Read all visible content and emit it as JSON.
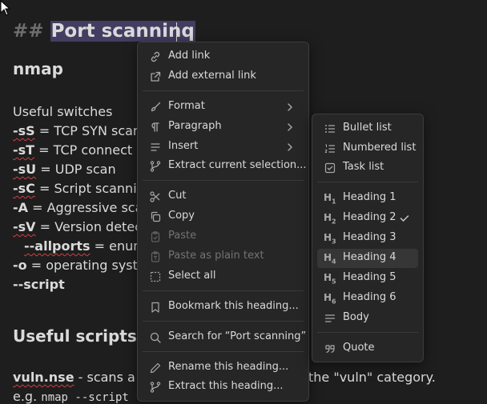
{
  "doc": {
    "heading_hash": "##",
    "heading_text": "Port scanning",
    "heading_visible": "Port scanninq",
    "h3_nmap": "nmap",
    "useful_switches": "Useful switches",
    "lines": [
      {
        "flag": "-sS",
        "rest": " = TCP SYN scan"
      },
      {
        "flag": "-sT",
        "rest": " = TCP connect s"
      },
      {
        "flag": "-sU",
        "rest": " = UDP scan"
      },
      {
        "flag": "-sC",
        "rest": " = Script scannin"
      },
      {
        "flag": "-A",
        "rest": " = Aggressive sca"
      },
      {
        "flag": "-sV",
        "rest": " = Version detect"
      },
      {
        "flag": "--allports",
        "rest": " = enume"
      },
      {
        "flag": "-o",
        "rest": " = operating syste"
      },
      {
        "flag": "--script",
        "rest": ""
      }
    ],
    "h3_scripts": "Useful scripts",
    "vuln_name": "vuln.nse",
    "vuln_text": " - scans a ta",
    "vuln_tail": "the \"vuln\" category.",
    "eg_prefix": "e.g. ",
    "eg_code": "nmap --script"
  },
  "menu": {
    "items": [
      {
        "label": "Add link",
        "icon": "link-icon"
      },
      {
        "label": "Add external link",
        "icon": "external-link-icon"
      },
      {
        "label": "Format",
        "icon": "brush-icon",
        "submenu": true
      },
      {
        "label": "Paragraph",
        "icon": "pilcrow-icon",
        "submenu": true
      },
      {
        "label": "Insert",
        "icon": "insert-icon",
        "submenu": true
      },
      {
        "label": "Extract current selection...",
        "icon": "git-fork-icon"
      },
      {
        "label": "Cut",
        "icon": "scissors-icon"
      },
      {
        "label": "Copy",
        "icon": "copy-icon"
      },
      {
        "label": "Paste",
        "icon": "clipboard-check-icon",
        "disabled": true
      },
      {
        "label": "Paste as plain text",
        "icon": "clipboard-type-icon",
        "disabled": true
      },
      {
        "label": "Select all",
        "icon": "select-all-icon"
      },
      {
        "label": "Bookmark this heading...",
        "icon": "bookmark-icon"
      },
      {
        "label": "Search for “Port scanning”",
        "icon": "search-icon"
      },
      {
        "label": "Rename this heading...",
        "icon": "pencil-icon"
      },
      {
        "label": "Extract this heading...",
        "icon": "git-fork-icon"
      }
    ]
  },
  "submenu": {
    "items": [
      {
        "label": "Bullet list",
        "icon": "bullet-list-icon"
      },
      {
        "label": "Numbered list",
        "icon": "numbered-list-icon"
      },
      {
        "label": "Task list",
        "icon": "task-list-icon"
      },
      {
        "label": "Heading 1",
        "icon": "heading-1-icon",
        "glyph": "H",
        "sub": "1"
      },
      {
        "label": "Heading 2",
        "icon": "heading-2-icon",
        "glyph": "H",
        "sub": "2",
        "checked": true
      },
      {
        "label": "Heading 3",
        "icon": "heading-3-icon",
        "glyph": "H",
        "sub": "3"
      },
      {
        "label": "Heading 4",
        "icon": "heading-4-icon",
        "glyph": "H",
        "sub": "4",
        "highlighted": true
      },
      {
        "label": "Heading 5",
        "icon": "heading-5-icon",
        "glyph": "H",
        "sub": "5"
      },
      {
        "label": "Heading 6",
        "icon": "heading-6-icon",
        "glyph": "H",
        "sub": "6"
      },
      {
        "label": "Body",
        "icon": "body-text-icon"
      },
      {
        "label": "Quote",
        "icon": "quote-icon"
      }
    ]
  },
  "colors": {
    "background": "#1e1e1e",
    "selection": "#433d61",
    "menu_bg": "#262626",
    "text": "#dadada"
  }
}
